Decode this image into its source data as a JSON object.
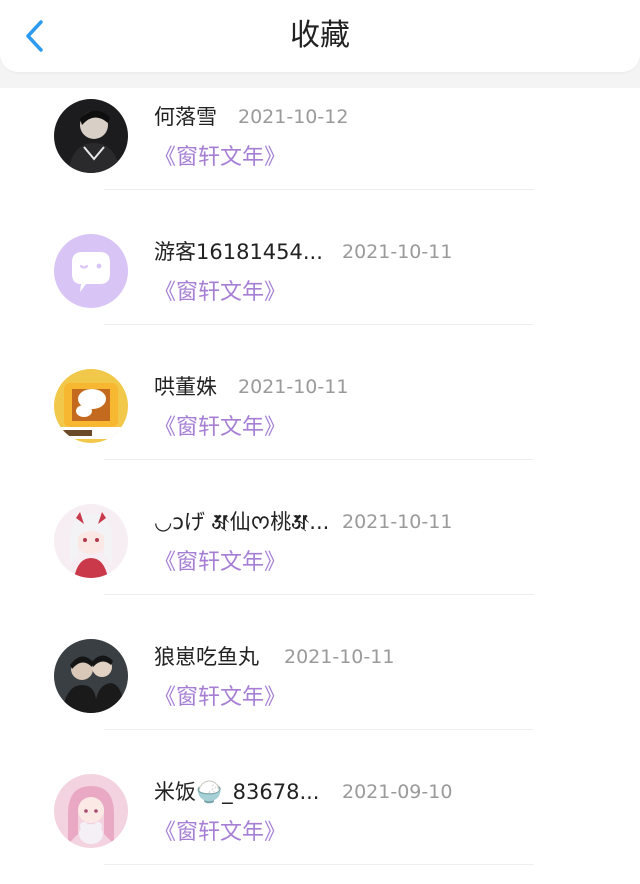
{
  "header": {
    "title": "收藏",
    "back_icon": "chevron-left-icon",
    "accent_color": "#2d9cf0"
  },
  "favorites": [
    {
      "name": "何落雪",
      "date": "2021-10-12",
      "book": "《窗轩文年》",
      "avatar": "photo-avatar"
    },
    {
      "name": "游客16181454...",
      "date": "2021-10-11",
      "book": "《窗轩文年》",
      "avatar": "default-chat-avatar"
    },
    {
      "name": "哄董姝",
      "date": "2021-10-11",
      "book": "《窗轩文年》",
      "avatar": "cartoon-avatar"
    },
    {
      "name": "◡ↄげ 𑖁仙ᰔ桃𑖁...",
      "date": "2021-10-11",
      "book": "《窗轩文年》",
      "avatar": "anime-girl-avatar"
    },
    {
      "name": "狼崽吃鱼丸",
      "date": "2021-10-11",
      "book": "《窗轩文年》",
      "avatar": "photo-avatar"
    },
    {
      "name": "米饭🍚_83678...",
      "date": "2021-09-10",
      "book": "《窗轩文年》",
      "avatar": "anime-girl-avatar"
    }
  ],
  "colors": {
    "book_title": "#a67fd4",
    "date": "#9a9a9a",
    "default_avatar_bg": "#d9c4f6"
  }
}
